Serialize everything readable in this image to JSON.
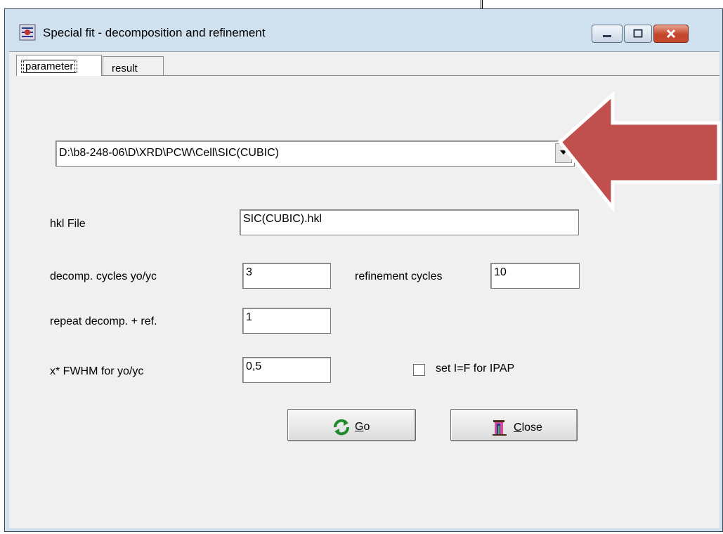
{
  "window": {
    "title": "Special fit - decomposition and refinement",
    "controls": [
      "minimize",
      "maximize",
      "close"
    ]
  },
  "tabs": [
    {
      "label": "parameter",
      "active": true
    },
    {
      "label": "result",
      "active": false
    }
  ],
  "form": {
    "path_combo": {
      "value": "D:\\b8-248-06\\D\\XRD\\PCW\\Cell\\SIC(CUBIC)"
    },
    "hkl_file": {
      "label": "hkl File",
      "value": "SIC(CUBIC).hkl"
    },
    "decomp_cycles": {
      "label": "decomp. cycles  yo/yc",
      "value": "3"
    },
    "refinement_cycles": {
      "label": "refinement cycles",
      "value": "10"
    },
    "repeat": {
      "label": "repeat decomp. + ref.",
      "value": "1"
    },
    "fwhm": {
      "label": "x* FWHM for yo/yc",
      "value": "0,5"
    },
    "set_ipap": {
      "label": "set  I=F  for  IPAP",
      "checked": false
    }
  },
  "buttons": {
    "go": {
      "prefix": "",
      "mnemonic": "G",
      "rest": "o"
    },
    "close": {
      "mnemonic": "C",
      "rest": "lose"
    }
  },
  "colors": {
    "frame": "#cfe0ef",
    "client": "#f0f0f0",
    "close_control": "#c2442a",
    "arrow_fill": "#c0504d",
    "arrow_stroke": "#ffffff"
  },
  "icons": [
    "app-icon",
    "minimize-icon",
    "maximize-icon",
    "close-icon",
    "dropdown-arrow-icon",
    "refresh-icon",
    "door-exit-icon",
    "annotation-arrow"
  ]
}
